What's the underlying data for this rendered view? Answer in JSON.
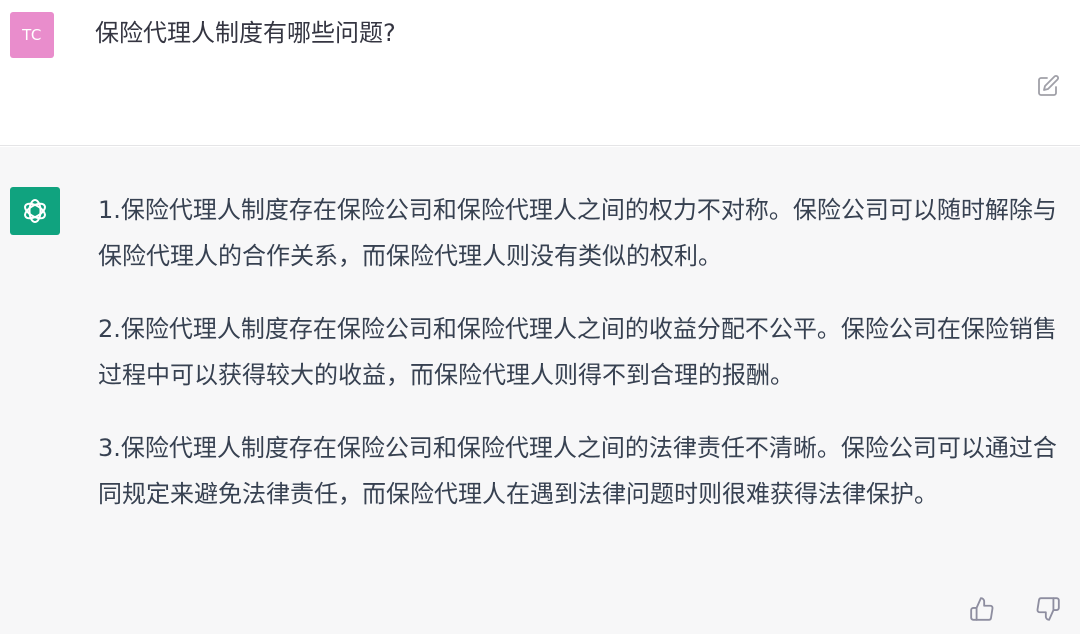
{
  "user": {
    "avatar_initials": "TC",
    "avatar_color": "#e98dcc",
    "question": "保险代理人制度有哪些问题?"
  },
  "assistant": {
    "avatar_color": "#10a37f",
    "avatar_icon": "openai-logo-icon",
    "paragraphs": [
      "1.保险代理人制度存在保险公司和保险代理人之间的权力不对称。保险公司可以随时解除与保险代理人的合作关系，而保险代理人则没有类似的权利。",
      "2.保险代理人制度存在保险公司和保险代理人之间的收益分配不公平。保险公司在保险销售过程中可以获得较大的收益，而保险代理人则得不到合理的报酬。",
      "3.保险代理人制度存在保险公司和保险代理人之间的法律责任不清晰。保险公司可以通过合同规定来避免法律责任，而保险代理人在遇到法律问题时则很难获得法律保护。"
    ]
  },
  "icons": {
    "edit": "edit-icon",
    "thumbs_up": "thumbs-up-icon",
    "thumbs_down": "thumbs-down-icon"
  }
}
